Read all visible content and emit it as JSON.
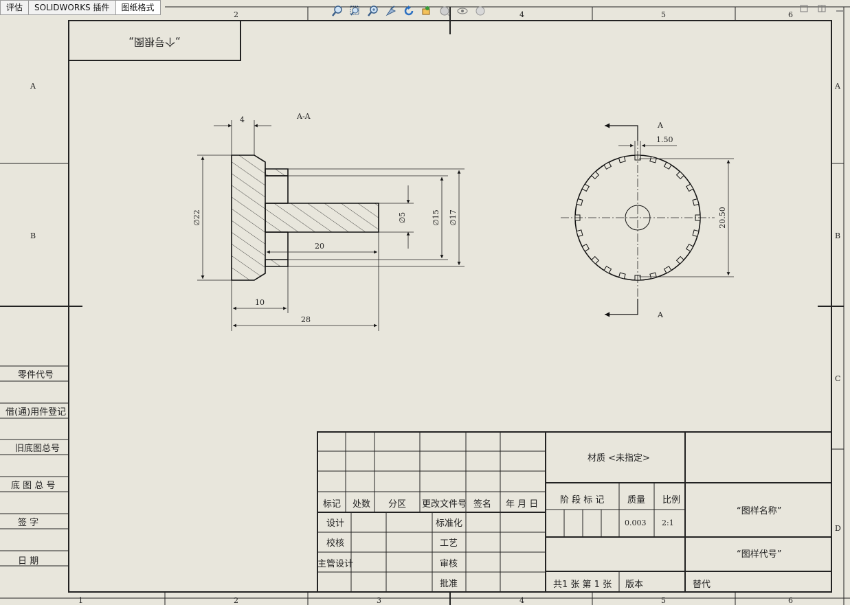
{
  "toolbar": {
    "tabs": [
      {
        "label": "评估"
      },
      {
        "label": "SOLIDWORKS 插件"
      },
      {
        "label": "图纸格式"
      }
    ],
    "view_tools": [
      "zoom-to-fit-icon",
      "zoom-to-area-icon",
      "zoom-in-out-icon",
      "select-icon",
      "rotate-icon",
      "pan-icon",
      "view-orientation-icon",
      "hide-show-icon",
      "appearance-icon"
    ]
  },
  "border": {
    "top_zones": [
      "2",
      "4",
      "5",
      "6"
    ],
    "bottom_zones": [
      "1",
      "2",
      "3",
      "4",
      "5",
      "6"
    ],
    "left_zones": [
      "A",
      "B"
    ],
    "right_zones": [
      "A",
      "B",
      "C",
      "D"
    ]
  },
  "left_panel": {
    "fields": [
      {
        "label": "零件代号"
      },
      {
        "label": "借(通)用件登记"
      },
      {
        "label": "旧底图总号"
      },
      {
        "label": "底 图 总 号"
      },
      {
        "label": "签   字"
      },
      {
        "label": "日   期"
      }
    ]
  },
  "mirror_box": {
    "text": "„个号根图„"
  },
  "section_view": {
    "title": "A-A",
    "dims": {
      "d4": "4",
      "d22": "∅22",
      "d5": "∅5",
      "d15": "∅15",
      "d17": "∅17",
      "d20": "20",
      "d10": "10",
      "d28": "28"
    }
  },
  "front_view": {
    "label_top": "A",
    "label_bottom": "A",
    "dim_150": "1.50",
    "dim_2050": "20.50"
  },
  "title_block": {
    "rev_headers": [
      "标记",
      "处数",
      "分区",
      "更改文件号",
      "签名",
      "年 月 日"
    ],
    "rows": [
      {
        "left": "设计",
        "mid": "标准化"
      },
      {
        "left": "校核",
        "mid": "工艺"
      },
      {
        "left": "主管设计",
        "mid": "审核"
      },
      {
        "left": "",
        "mid": "批准"
      }
    ],
    "material": "材质 <未指定>",
    "stage_label": "阶 段 标 记",
    "mass_label": "质量",
    "scale_label": "比例",
    "mass_value": "0.003",
    "scale_value": "2:1",
    "drawing_name": "“图样名称”",
    "drawing_number": "“图样代号”",
    "sheets": "共1 张   第 1 张",
    "version": "版本",
    "replace": "替代"
  }
}
